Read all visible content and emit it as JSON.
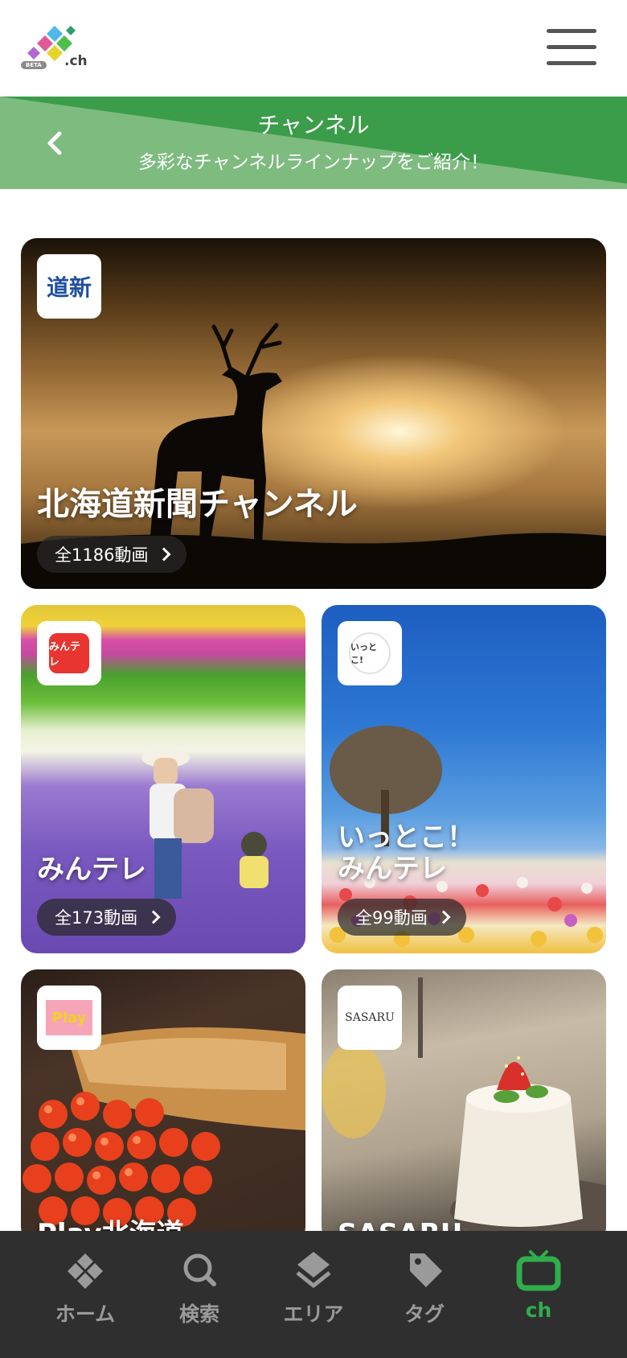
{
  "header": {
    "logo_suffix": ".ch",
    "beta_badge": "BETA",
    "menu_icon": "hamburger-icon"
  },
  "banner": {
    "title": "チャンネル",
    "subtitle": "多彩なチャンネルラインナップをご紹介！",
    "back_icon": "chevron-left-icon",
    "colors": {
      "dark": "#3b9c4a",
      "light": "#7dbb7f"
    }
  },
  "channels": [
    {
      "name": "北海道新聞チャンネル",
      "count": "全1186動画",
      "logo_text": "道新"
    },
    {
      "name": "みんテレ",
      "count": "全173動画",
      "logo_text": "みんテレ"
    },
    {
      "name": "いっとこ！\nみんテレ",
      "count": "全99動画",
      "logo_text": "いっとこ!"
    },
    {
      "name": "Play北海道",
      "count": "",
      "logo_text": "Play"
    },
    {
      "name": "SASARU",
      "count": "",
      "logo_text": "SASARU"
    }
  ],
  "bottom_nav": {
    "items": [
      {
        "label": "ホーム",
        "icon": "home-icon",
        "active": false
      },
      {
        "label": "検索",
        "icon": "search-icon",
        "active": false
      },
      {
        "label": "エリア",
        "icon": "area-icon",
        "active": false
      },
      {
        "label": "タグ",
        "icon": "tag-icon",
        "active": false
      },
      {
        "label": "ch",
        "icon": "tv-icon",
        "active": true
      }
    ],
    "active_color": "#2fae4b"
  }
}
